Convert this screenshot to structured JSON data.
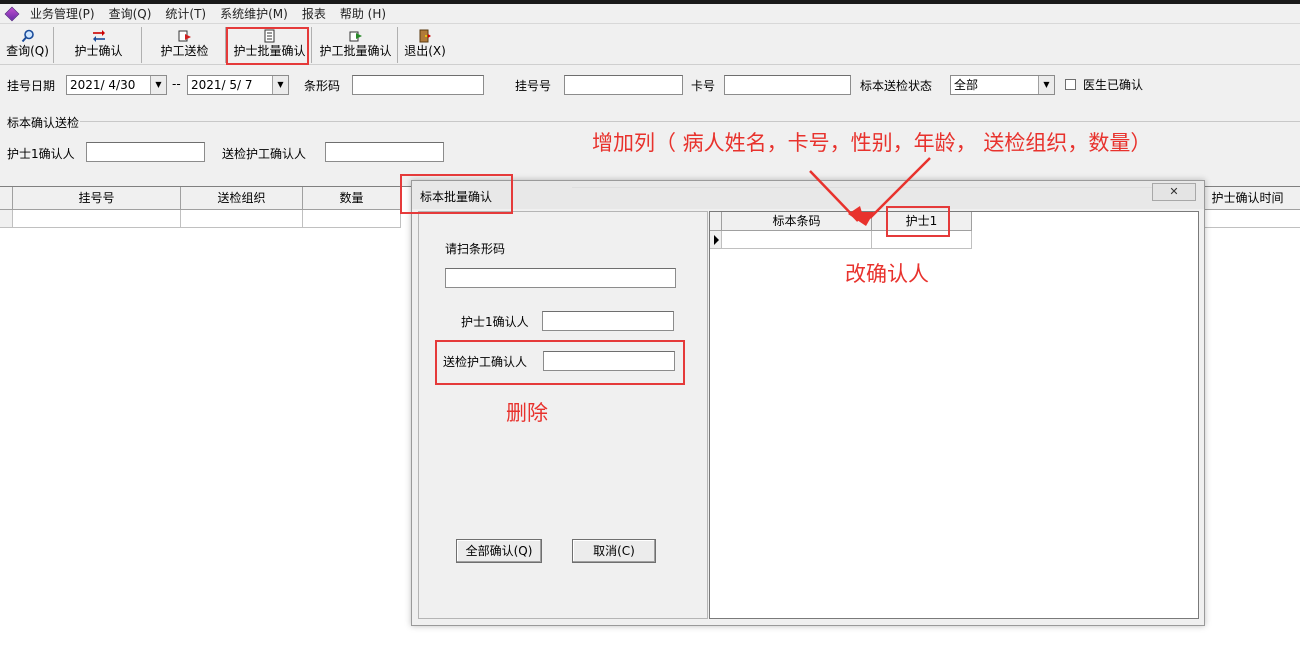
{
  "menu": [
    "业务管理(P)",
    "查询(Q)",
    "统计(T)",
    "系统维护(M)",
    "报表",
    "帮助 (H)"
  ],
  "toolbar": {
    "query": "查询(Q)",
    "nurse_confirm": "护士确认",
    "worker_send": "护工送检",
    "nurse_batch": "护士批量确认",
    "worker_batch": "护工批量确认",
    "exit": "退出(X)"
  },
  "filters": {
    "reg_date_label": "挂号日期",
    "date_from": "2021/ 4/30",
    "date_sep": "--",
    "date_to": "2021/ 5/ 7",
    "barcode_label": "条形码",
    "reg_no_label": "挂号号",
    "card_label": "卡号",
    "status_label": "标本送检状态",
    "status_value": "全部",
    "doctor_confirmed_label": "医生已确认"
  },
  "section": {
    "title": "标本确认送检",
    "nurse1_label": "护士1确认人",
    "worker_label": "送检护工确认人"
  },
  "grid": {
    "columns": [
      "挂号号",
      "送检组织",
      "数量",
      "护士确认时间"
    ]
  },
  "dialog": {
    "title": "标本批量确认",
    "close": "✕",
    "scan_label": "请扫条形码",
    "nurse1_label": "护士1确认人",
    "worker_label": "送检护工确认人",
    "confirm_all": "全部确认(Q)",
    "cancel": "取消(C)",
    "table_columns": [
      "标本条码",
      "护士1"
    ]
  },
  "annotations": {
    "add_columns": "增加列（ 病人姓名，卡号，性别，年龄，  送检组织，数量）",
    "change_confirmer": "改确认人",
    "delete": "删除",
    "color": "#e8322d"
  }
}
